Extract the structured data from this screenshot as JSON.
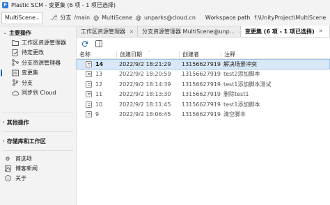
{
  "window": {
    "title": "Plastic SCM - 变更集 (6 项 - 1 项已选择)"
  },
  "toolbar": {
    "workspace": "MultiScene",
    "branch_label": "分支",
    "branch_value": "/main",
    "at1": "@",
    "repo": "MultiScene",
    "at2": "@",
    "server": "unparks@cloud.cn",
    "workspace_path_label": "Workspace path",
    "workspace_path": "f:\\UnityProject\\MultiScene"
  },
  "sidebar": {
    "main_section": "主要操作",
    "items": [
      {
        "label": "工作区资源管理器",
        "icon": "folder-icon"
      },
      {
        "label": "待定更改",
        "icon": "pending-changes-icon"
      },
      {
        "label": "分支资源管理器",
        "icon": "branch-explorer-icon"
      },
      {
        "label": "变更集",
        "icon": "changesets-icon"
      },
      {
        "label": "分支",
        "icon": "branch-icon"
      },
      {
        "label": "同步到 Cloud",
        "icon": "cloud-sync-icon"
      }
    ],
    "other_section": "其他操作",
    "repos_section": "存储库和工作区",
    "footer": [
      {
        "label": "首选项",
        "icon": "gear-icon"
      },
      {
        "label": "博客新闻",
        "icon": "news-icon"
      },
      {
        "label": "关于",
        "icon": "info-icon"
      }
    ]
  },
  "tabs": [
    {
      "label": "工作区资源管理器",
      "active": false
    },
    {
      "label": "分支资源管理器 MultiScene@unp...",
      "active": false
    },
    {
      "label": "变更集 (6 项 - 1 项已选择)",
      "active": true
    }
  ],
  "table": {
    "headers": {
      "name": "名称",
      "date": "创建日期",
      "creator": "创建者",
      "comment": "注释"
    },
    "rows": [
      {
        "name": "14",
        "date": "2022/9/2 18:21:29",
        "creator": "13156627919...",
        "comment": "解决场景冲突",
        "selected": true
      },
      {
        "name": "13",
        "date": "2022/9/2 18:20:59",
        "creator": "13156627919...",
        "comment": "test2添加脚本",
        "selected": false
      },
      {
        "name": "12",
        "date": "2022/9/2 18:14:39",
        "creator": "13156627919...",
        "comment": "test1添加脚本测试",
        "selected": false
      },
      {
        "name": "11",
        "date": "2022/9/2 18:13:30",
        "creator": "13156627919...",
        "comment": "删除test1",
        "selected": false
      },
      {
        "name": "10",
        "date": "2022/9/2 18:11:45",
        "creator": "13156627919...",
        "comment": "test1添加脚本",
        "selected": false
      },
      {
        "name": "9",
        "date": "2022/9/2 18:06:45",
        "creator": "13156627919...",
        "comment": "清空脚本",
        "selected": false
      }
    ]
  }
}
